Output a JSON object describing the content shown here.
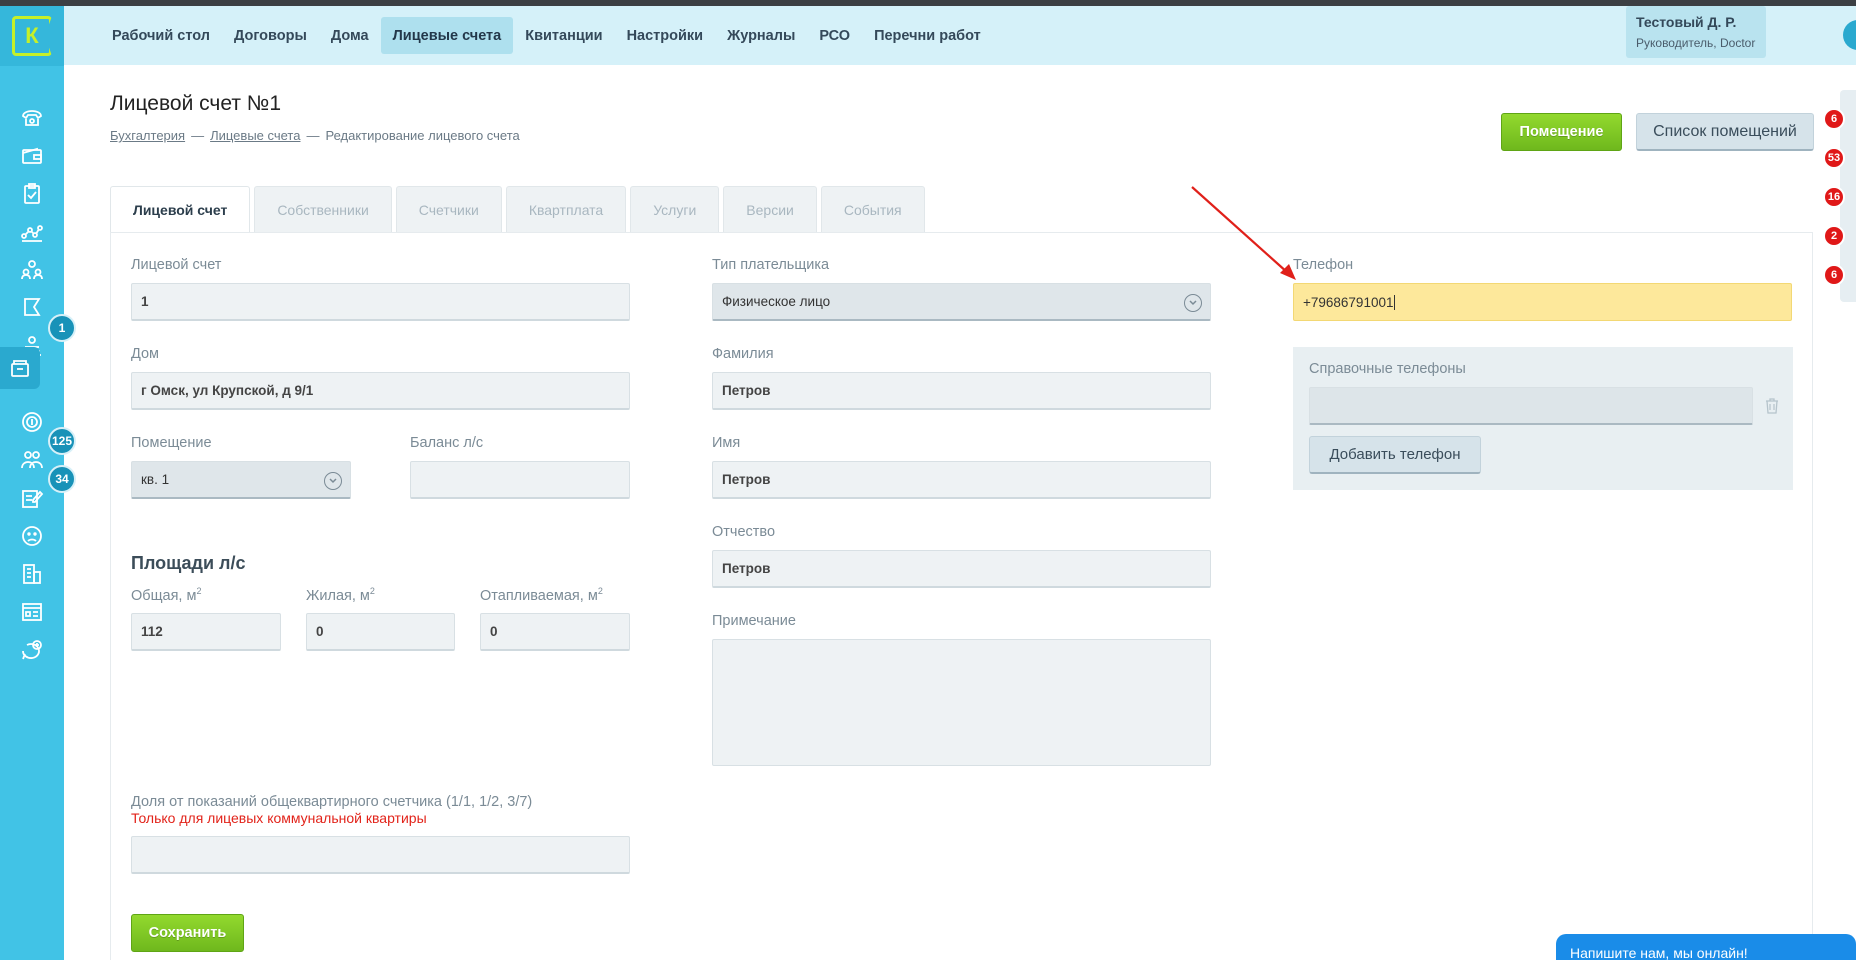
{
  "logo": {
    "letter": "К"
  },
  "header": {
    "nav": [
      {
        "label": "Рабочий стол"
      },
      {
        "label": "Договоры"
      },
      {
        "label": "Дома"
      },
      {
        "label": "Лицевые счета"
      },
      {
        "label": "Квитанции"
      },
      {
        "label": "Настройки"
      },
      {
        "label": "Журналы"
      },
      {
        "label": "РСО"
      },
      {
        "label": "Перечни работ"
      }
    ],
    "active_nav": "Лицевые счета",
    "user": {
      "name": "Тестовый Д. Р.",
      "role": "Руководитель, Doctor"
    }
  },
  "sidebar": {
    "icons": [
      {
        "name": "phone-icon"
      },
      {
        "name": "wallet-icon"
      },
      {
        "name": "clipboard-icon"
      },
      {
        "name": "network-icon"
      },
      {
        "name": "people-icon"
      },
      {
        "name": "flag-icon"
      },
      {
        "name": "operator-icon",
        "badge": "1"
      },
      {
        "name": "archive-icon",
        "active": true
      },
      {
        "name": "coin-icon"
      },
      {
        "name": "group-icon",
        "badge": "125"
      },
      {
        "name": "edit-icon",
        "badge": "34"
      },
      {
        "name": "sad-face-icon"
      },
      {
        "name": "building-icon"
      },
      {
        "name": "document-icon"
      },
      {
        "name": "chat-add-icon"
      }
    ]
  },
  "page": {
    "title": "Лицевой счет №1",
    "breadcrumb": {
      "item1": "Бухгалтерия",
      "sep": "—",
      "item2": "Лицевые счета",
      "item3": "Редактирование лицевого счета"
    },
    "buttons": {
      "room": "Помещение",
      "room_list": "Список помещений"
    }
  },
  "right_badges": [
    "6",
    "53",
    "16",
    "2",
    "6"
  ],
  "tabs": [
    {
      "label": "Лицевой счет",
      "active": true
    },
    {
      "label": "Собственники"
    },
    {
      "label": "Счетчики"
    },
    {
      "label": "Квартплата"
    },
    {
      "label": "Услуги"
    },
    {
      "label": "Версии"
    },
    {
      "label": "События"
    }
  ],
  "form": {
    "account": {
      "label": "Лицевой счет",
      "value": "1"
    },
    "house": {
      "label": "Дом",
      "value": "г Омск, ул Крупской, д 9/1"
    },
    "room": {
      "label": "Помещение",
      "value": "кв. 1"
    },
    "balance": {
      "label": "Баланс л/с",
      "value": ""
    },
    "areas_title": "Площади л/с",
    "area_total": {
      "label": "Общая, м",
      "value": "112"
    },
    "area_living": {
      "label": "Жилая, м",
      "value": "0"
    },
    "area_heated": {
      "label": "Отапливаемая, м",
      "value": "0"
    },
    "sup2": "2",
    "share": {
      "label": "Доля от показаний общеквартирного счетчика (1/1, 1/2, 3/7)",
      "warning": "Только для лицевых коммунальной квартиры",
      "value": ""
    },
    "payer_type": {
      "label": "Тип плательщика",
      "value": "Физическое лицо"
    },
    "lastname": {
      "label": "Фамилия",
      "value": "Петров"
    },
    "firstname": {
      "label": "Имя",
      "value": "Петров"
    },
    "middlename": {
      "label": "Отчество",
      "value": "Петров"
    },
    "note": {
      "label": "Примечание",
      "value": ""
    },
    "phone": {
      "label": "Телефон",
      "value": "+79686791001"
    },
    "ref_phones": {
      "label": "Справочные телефоны",
      "value": "",
      "add_button": "Добавить телефон"
    },
    "save_button": "Сохранить"
  },
  "chat": {
    "text": "Напишите нам, мы онлайн!"
  },
  "colors": {
    "accent": "#41c3e6",
    "green": "#7cc624",
    "highlight": "#fde89b",
    "badge_red": "#e01818",
    "arrow": "#e0201a"
  }
}
